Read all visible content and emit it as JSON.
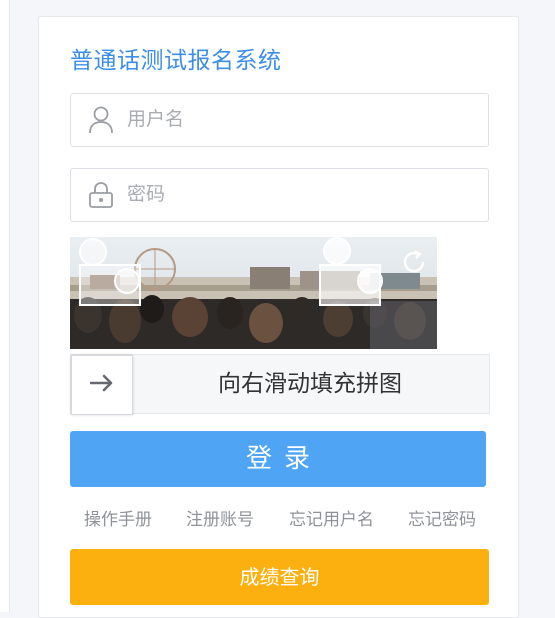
{
  "app": {
    "title": "普通话测试报名系统"
  },
  "form": {
    "username_placeholder": "用户名",
    "username_value": "",
    "password_placeholder": "密码",
    "password_value": "",
    "username_icon": "user-icon",
    "password_icon": "lock-icon"
  },
  "captcha": {
    "refresh_icon": "refresh-icon",
    "slider_icon": "arrow-right-icon",
    "slider_label": "向右滑动填充拼图"
  },
  "buttons": {
    "login_label": "登录",
    "query_label": "成绩查询"
  },
  "links": [
    {
      "label": "操作手册"
    },
    {
      "label": "注册账号"
    },
    {
      "label": "忘记用户名"
    },
    {
      "label": "忘记密码"
    }
  ],
  "colors": {
    "title": "#3d8ee8",
    "login_button": "#4fa4f4",
    "query_button": "#fbb00f"
  }
}
